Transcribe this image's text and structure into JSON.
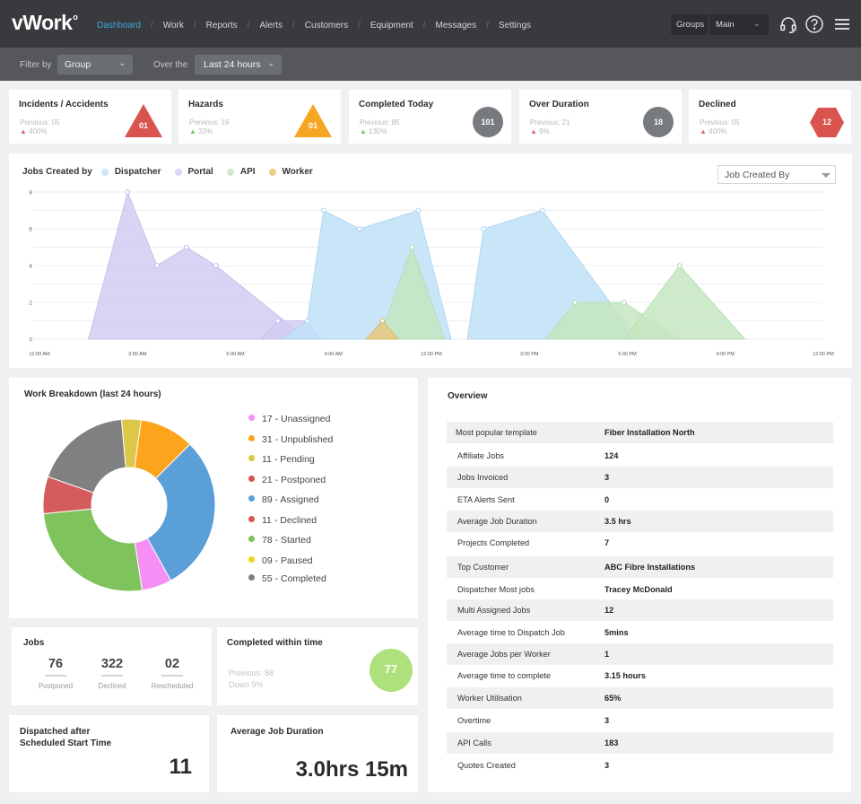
{
  "app": {
    "logo": "vWork",
    "nav": [
      "Dashboard",
      "Work",
      "Reports",
      "Alerts",
      "Customers",
      "Equipment",
      "Messages",
      "Settings"
    ],
    "active_nav": "Dashboard",
    "groups_label": "Groups",
    "groups_value": "Main",
    "icons": [
      "headset-icon",
      "help-icon",
      "menu-icon"
    ]
  },
  "filters": {
    "filter_by_label": "Filter by",
    "filter_by_value": "Group",
    "over_label": "Over the",
    "over_value": "Last 24 hours"
  },
  "kpis": [
    {
      "title": "Incidents / Accidents",
      "previous": "Previous: 05",
      "change": "400%",
      "change_dir": "up-red",
      "value": "01",
      "shape": "triangle",
      "color": "#d9534f"
    },
    {
      "title": "Hazards",
      "previous": "Previous: 19",
      "change": "33%",
      "change_dir": "up-green",
      "value": "01",
      "shape": "triangle",
      "color": "#f5a623"
    },
    {
      "title": "Completed Today",
      "previous": "Previous: 85",
      "change": "130%",
      "change_dir": "up-green",
      "value": "101",
      "shape": "circle",
      "color": "#777a7e"
    },
    {
      "title": "Over Duration",
      "previous": "Previous: 21",
      "change": "9%",
      "change_dir": "up-red",
      "value": "18",
      "shape": "circle",
      "color": "#777a7e"
    },
    {
      "title": "Declined",
      "previous": "Previous: 05",
      "change": "400%",
      "change_dir": "up-red",
      "value": "12",
      "shape": "hexagon",
      "color": "#d9534f"
    }
  ],
  "jobs_chart": {
    "legend_title": "Jobs Created by",
    "dropdown": "Job Created By",
    "series_colors": {
      "Dispatcher": "#bfe0f7",
      "Portal": "#d4cdf2",
      "API": "#c6e6c2",
      "Worker": "#e9c97e"
    },
    "chart_data": {
      "type": "area",
      "x_ticks": [
        "12:00 AM",
        "3:00 AM",
        "6:00 AM",
        "9:00 AM",
        "12:00 PM",
        "3:00 PM",
        "6:00 PM",
        "9:00 PM",
        "12:00 PM"
      ],
      "ylim": [
        0,
        8
      ],
      "y_ticks": [
        "0",
        "2",
        "4",
        "6",
        "8"
      ],
      "grid": true,
      "legend_placement": "top-left",
      "series": [
        {
          "name": "Portal",
          "points": [
            [
              1.5,
              0
            ],
            [
              2.7,
              8
            ],
            [
              3.6,
              4
            ],
            [
              4.5,
              5
            ],
            [
              5.4,
              4
            ],
            [
              8.2,
              0
            ]
          ]
        },
        {
          "name": "Portal",
          "points": [
            [
              6.8,
              0
            ],
            [
              7.3,
              1
            ],
            [
              8.2,
              1
            ],
            [
              8.6,
              0
            ]
          ]
        },
        {
          "name": "Dispatcher",
          "points": [
            [
              7.4,
              0
            ],
            [
              8.2,
              1
            ],
            [
              8.7,
              7
            ],
            [
              9.8,
              6
            ],
            [
              11.6,
              7
            ],
            [
              12.6,
              0
            ]
          ]
        },
        {
          "name": "Dispatcher",
          "points": [
            [
              13.1,
              0
            ],
            [
              13.6,
              6
            ],
            [
              15.4,
              7
            ],
            [
              18.3,
              0
            ]
          ]
        },
        {
          "name": "API",
          "points": [
            [
              10.4,
              0
            ],
            [
              11.4,
              5
            ],
            [
              12.4,
              0
            ]
          ]
        },
        {
          "name": "API",
          "points": [
            [
              15.5,
              0
            ],
            [
              16.4,
              2
            ],
            [
              17.9,
              2
            ],
            [
              19.6,
              0
            ]
          ]
        },
        {
          "name": "API",
          "points": [
            [
              17.9,
              0
            ],
            [
              19.6,
              4
            ],
            [
              21.6,
              0
            ]
          ]
        },
        {
          "name": "Worker",
          "points": [
            [
              10.0,
              0
            ],
            [
              10.5,
              1
            ],
            [
              11.0,
              0
            ]
          ]
        }
      ]
    }
  },
  "work_breakdown": {
    "title": "Work Breakdown (last 24 hours)",
    "chart_data": {
      "type": "pie",
      "labels": [
        "Unassigned",
        "Unpublished",
        "Pending",
        "Postponed",
        "Assigned",
        "Declined",
        "Started",
        "Paused",
        "Completed"
      ],
      "display": [
        "17 - Unassigned",
        "31 - Unpublished",
        "11 - Pending",
        "21 - Postponed",
        "89 - Assigned",
        "11 - Declined",
        "78 - Started",
        "09 - Paused",
        "55 - Completed"
      ],
      "legend_colors": [
        "#f58ff5",
        "#fca41b",
        "#dcc749",
        "#d9534f",
        "#5a9fd8",
        "#d9534f",
        "#7ec35b",
        "#f2d317",
        "#808080"
      ],
      "slices": [
        {
          "label": "Unpublished",
          "value": 31,
          "color": "#fca41b"
        },
        {
          "label": "Assigned",
          "value": 89,
          "color": "#5a9fd8"
        },
        {
          "label": "Unassigned",
          "value": 17,
          "color": "#f58ff5"
        },
        {
          "label": "Started",
          "value": 78,
          "color": "#7ec35b"
        },
        {
          "label": "Postponed",
          "value": 21,
          "color": "#d55c5c"
        },
        {
          "label": "Completed",
          "value": 55,
          "color": "#808080"
        },
        {
          "label": "Pending",
          "value": 11,
          "color": "#dcc749"
        }
      ]
    }
  },
  "jobs_card": {
    "title": "Jobs",
    "stats": [
      {
        "value": "76",
        "label": "Postponed"
      },
      {
        "value": "322",
        "label": "Declined"
      },
      {
        "value": "02",
        "label": "Rescheduled"
      }
    ]
  },
  "completed_within": {
    "title": "Completed within time",
    "previous": "Previous: 88",
    "change": "Down 9%",
    "value": "77",
    "color": "#aee07b"
  },
  "dispatched_after": {
    "title_line1": "Dispatched after",
    "title_line2": "Scheduled Start Time",
    "value": "11"
  },
  "avg_job_duration": {
    "title": "Average Job Duration",
    "value": "3.0hrs 15m"
  },
  "overview": {
    "title": "Overview",
    "rows": [
      {
        "key": "Most popular template",
        "value": "Fiber Installation North"
      },
      {
        "key": "Affiliate Jobs",
        "value": "124"
      },
      {
        "key": "Jobs Invoiced",
        "value": "3"
      },
      {
        "key": "ETA Alerts Sent",
        "value": "0"
      },
      {
        "key": "Average Job Duration",
        "value": "3.5 hrs"
      },
      {
        "key": "Projects Completed",
        "value": "7"
      },
      {
        "key": "Top Customer",
        "value": "ABC Fibre Installations"
      },
      {
        "key": "Dispatcher Most jobs",
        "value": "Tracey McDonald"
      },
      {
        "key": "Multi Assigned Jobs",
        "value": "12"
      },
      {
        "key": "Average time to Dispatch Job",
        "value": "5mins"
      },
      {
        "key": "Average Jobs per Worker",
        "value": "1"
      },
      {
        "key": "Average time to complete",
        "value": "3.15 hours"
      },
      {
        "key": "Worker Utilisation",
        "value": "65%"
      },
      {
        "key": "Overtime",
        "value": "3"
      },
      {
        "key": "API Calls",
        "value": "183"
      },
      {
        "key": "Quotes Created",
        "value": "3"
      }
    ]
  }
}
